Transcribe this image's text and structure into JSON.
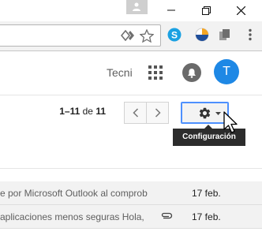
{
  "header": {
    "account_name": "Tecni",
    "avatar_initial": "T"
  },
  "pager": {
    "range": "1–11",
    "of_label": "de",
    "total": "11"
  },
  "settings": {
    "tooltip": "Configuración"
  },
  "mail_rows": [
    {
      "snippet": "e por Microsoft Outlook al comprob",
      "date": "17 feb.",
      "has_attachment": false
    },
    {
      "snippet": "aplicaciones menos seguras Hola,",
      "date": "17 feb.",
      "has_attachment": true
    }
  ],
  "icons": {
    "user": "person-icon",
    "minimize": "minimize-icon",
    "restore": "restore-icon",
    "close": "close-icon",
    "omnibox_left": "translate-icon",
    "bookmark": "star-icon",
    "extensions": [
      "skype-icon",
      "circle-extension-icon",
      "copy-extension-icon"
    ],
    "menu": "menu-icon",
    "apps": "apps-grid-icon",
    "notifications": "bell-icon",
    "older": "chevron-left-icon",
    "newer": "chevron-right-icon",
    "settings": "gear-icon",
    "attachment": "paperclip-icon"
  },
  "colors": {
    "accent": "#1e88e5",
    "focus_border": "#4d90fe",
    "tooltip_bg": "#2c2c2c"
  }
}
